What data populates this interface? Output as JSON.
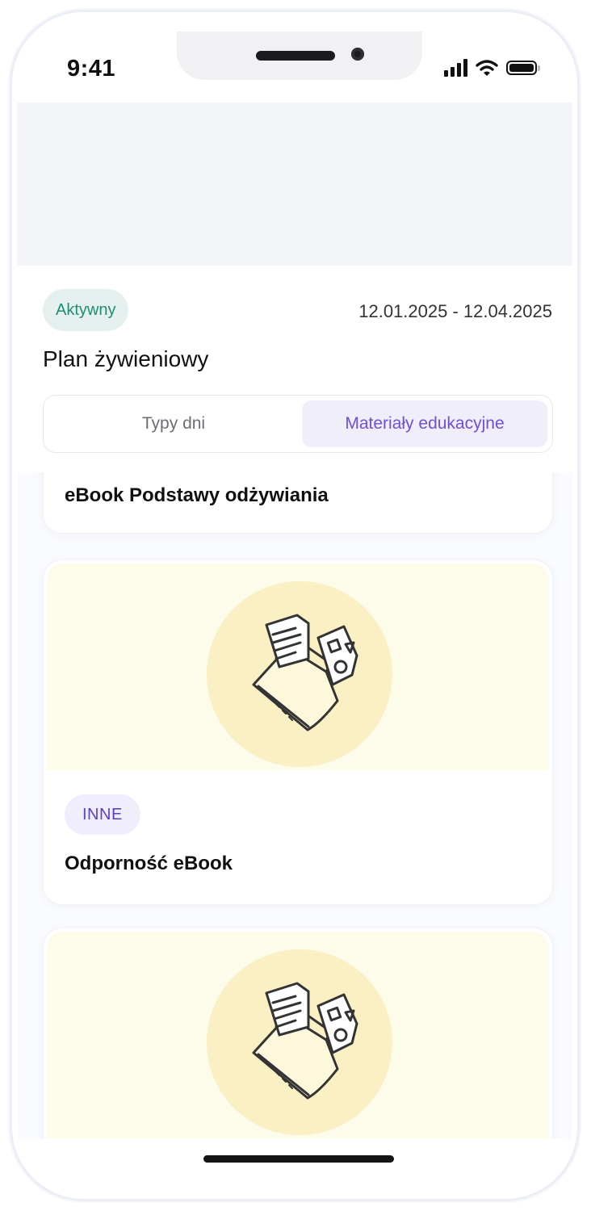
{
  "status_bar": {
    "time": "9:41",
    "icons": [
      "signal-icon",
      "wifi-icon",
      "battery-icon"
    ]
  },
  "plan": {
    "status": "Aktywny",
    "date_range": "12.01.2025 - 12.04.2025",
    "title": "Plan żywieniowy"
  },
  "tabs": [
    {
      "label": "Typy dni",
      "active": false
    },
    {
      "label": "Materiały edukacyjne",
      "active": true
    }
  ],
  "materials": [
    {
      "title": "eBook Podstawy odżywiania"
    },
    {
      "category": "INNE",
      "title": "Odporność eBook",
      "icon": "folder-documents-icon"
    },
    {
      "icon": "folder-documents-icon"
    }
  ],
  "colors": {
    "accent": "#6f4fd6",
    "active_badge": "#1e8e75",
    "thumb_bg": "#fdfbea",
    "thumb_circle": "#faf0c4"
  }
}
